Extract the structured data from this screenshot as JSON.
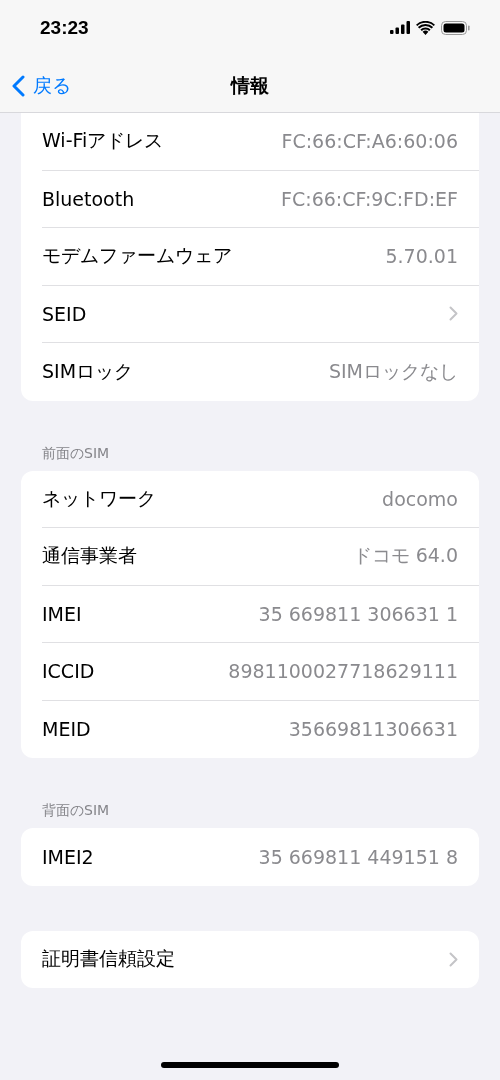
{
  "status_bar": {
    "time": "23:23"
  },
  "nav": {
    "back": "戻る",
    "title": "情報"
  },
  "groups": [
    {
      "rows": [
        {
          "kind": "value",
          "label": "Wi-Fiアドレス",
          "value": "FC:66:CF:A6:60:06"
        },
        {
          "kind": "value",
          "label": "Bluetooth",
          "value": "FC:66:CF:9C:FD:EF"
        },
        {
          "kind": "value",
          "label": "モデムファームウェア",
          "value": "5.70.01"
        },
        {
          "kind": "link",
          "label": "SEID"
        },
        {
          "kind": "value",
          "label": "SIMロック",
          "value": "SIMロックなし"
        }
      ]
    },
    {
      "header": "前面のSIM",
      "rows": [
        {
          "kind": "value",
          "label": "ネットワーク",
          "value": "docomo"
        },
        {
          "kind": "value",
          "label": "通信事業者",
          "value": "ドコモ 64.0"
        },
        {
          "kind": "value",
          "label": "IMEI",
          "value": "35 669811 306631 1"
        },
        {
          "kind": "value",
          "label": "ICCID",
          "value": "8981100027718629111"
        },
        {
          "kind": "value",
          "label": "MEID",
          "value": "35669811306631"
        }
      ]
    },
    {
      "header": "背面のSIM",
      "rows": [
        {
          "kind": "value",
          "label": "IMEI2",
          "value": "35 669811 449151 8"
        }
      ]
    },
    {
      "rows": [
        {
          "kind": "link",
          "label": "証明書信頼設定"
        }
      ]
    }
  ]
}
